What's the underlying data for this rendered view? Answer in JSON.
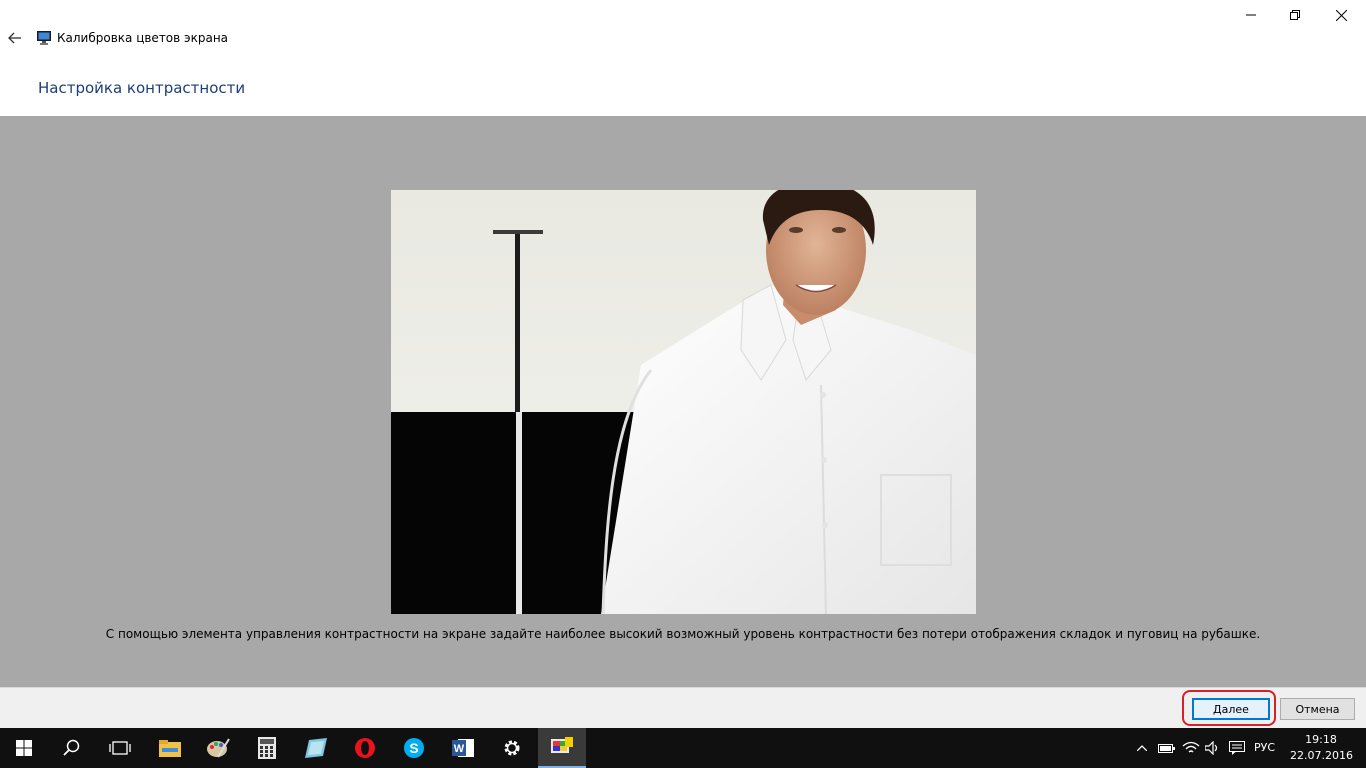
{
  "window": {
    "app_title": "Калибровка цветов экрана",
    "page_title": "Настройка контрастности"
  },
  "content": {
    "instruction": "С помощью элемента управления контрастности на экране задайте наиболее высокий возможный уровень контрастности без потери отображения складок и пуговиц на рубашке."
  },
  "footer": {
    "next_label": "Далее",
    "cancel_label": "Отмена"
  },
  "taskbar": {
    "items": [
      "start-icon",
      "search-icon",
      "task-view-icon",
      "file-explorer-icon",
      "paint-icon",
      "calculator-icon",
      "notes-icon",
      "opera-icon",
      "skype-icon",
      "word-icon",
      "settings-icon",
      "color-calibration-icon"
    ],
    "language": "РУС",
    "time": "19:18",
    "date": "22.07.2016"
  },
  "colors": {
    "title_blue": "#1e3d78",
    "content_gray": "#a8a8a8",
    "highlight_red": "#d6202a",
    "accent": "#0078d7"
  }
}
